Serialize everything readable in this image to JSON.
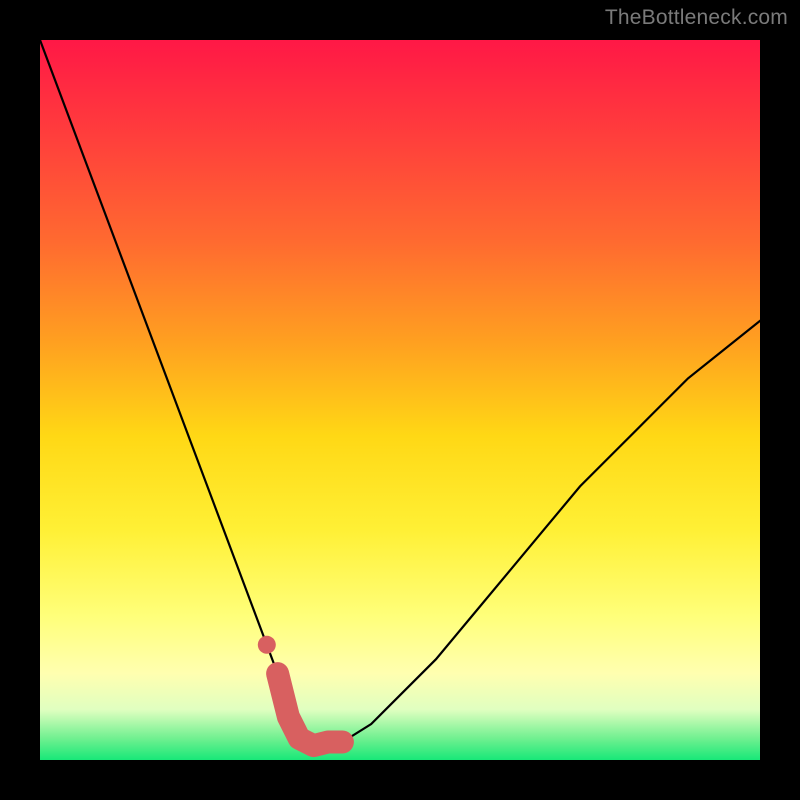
{
  "watermark": "TheBottleneck.com",
  "chart_data": {
    "type": "line",
    "title": "",
    "xlabel": "",
    "ylabel": "",
    "xlim": [
      0,
      100
    ],
    "ylim": [
      0,
      100
    ],
    "grid": false,
    "legend": false,
    "series": [
      {
        "name": "curve",
        "x": [
          0,
          3,
          6,
          9,
          12,
          15,
          18,
          21,
          24,
          27,
          30,
          33,
          34.5,
          36,
          38,
          40,
          42,
          46,
          50,
          55,
          60,
          65,
          70,
          75,
          80,
          85,
          90,
          95,
          100
        ],
        "values": [
          100,
          92,
          84,
          76,
          68,
          60,
          52,
          44,
          36,
          28,
          20,
          12,
          6,
          3,
          2,
          2.5,
          2.5,
          5,
          9,
          14,
          20,
          26,
          32,
          38,
          43,
          48,
          53,
          57,
          61
        ]
      }
    ],
    "markers": [
      {
        "name": "u-highlight",
        "color": "#d86060",
        "width": 3.2,
        "x": [
          33,
          34.5,
          36,
          38,
          40,
          42
        ],
        "values": [
          12,
          6,
          3,
          2,
          2.5,
          2.5
        ]
      },
      {
        "name": "dot-left",
        "color": "#d86060",
        "type": "dot",
        "x": 31.5,
        "value": 16,
        "r": 1.2
      }
    ]
  }
}
